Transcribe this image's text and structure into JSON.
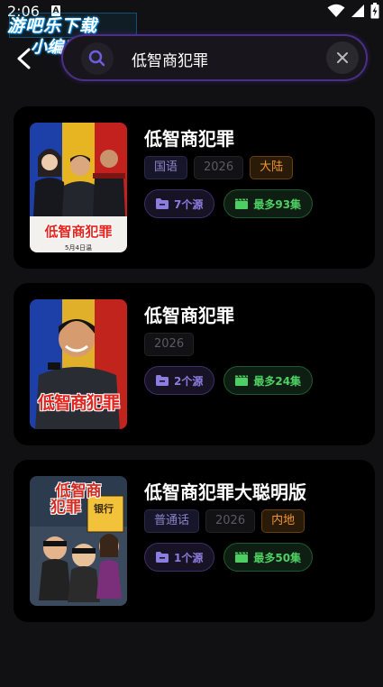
{
  "status_bar": {
    "time": "2:06",
    "notification_icon": "A",
    "icons": [
      "wifi-icon",
      "signal-icon",
      "battery-icon"
    ]
  },
  "watermark": {
    "line1": "游吧乐下载",
    "line2": "小编亲测"
  },
  "search": {
    "value": "低智商犯罪",
    "icon": "search-icon",
    "clear_icon": "close-icon"
  },
  "results": [
    {
      "title": "低智商犯罪",
      "poster_title": "低智商犯罪",
      "poster_date": "5月4日温",
      "tags": [
        {
          "type": "lang",
          "label": "国语"
        },
        {
          "type": "year",
          "label": "2026"
        },
        {
          "type": "region",
          "label": "大陆"
        }
      ],
      "sources_label": "7个源",
      "episodes_label": "最多93集"
    },
    {
      "title": "低智商犯罪",
      "poster_title": "低智商犯罪",
      "tags": [
        {
          "type": "year",
          "label": "2026"
        }
      ],
      "sources_label": "2个源",
      "episodes_label": "最多24集"
    },
    {
      "title": "低智商犯罪大聪明版",
      "poster_title_1": "低智商",
      "poster_title_2": "犯罪",
      "poster_sign": "银行",
      "tags": [
        {
          "type": "lang",
          "label": "普通话"
        },
        {
          "type": "year",
          "label": "2026"
        },
        {
          "type": "region",
          "label": "内地"
        }
      ],
      "sources_label": "1个源",
      "episodes_label": "最多50集"
    }
  ],
  "colors": {
    "background": "#111113",
    "card": "#000000",
    "search_border": "#4b2f86",
    "source_accent": "#8c7de0",
    "episode_accent": "#4dcf63",
    "region_accent": "#f0952e"
  }
}
